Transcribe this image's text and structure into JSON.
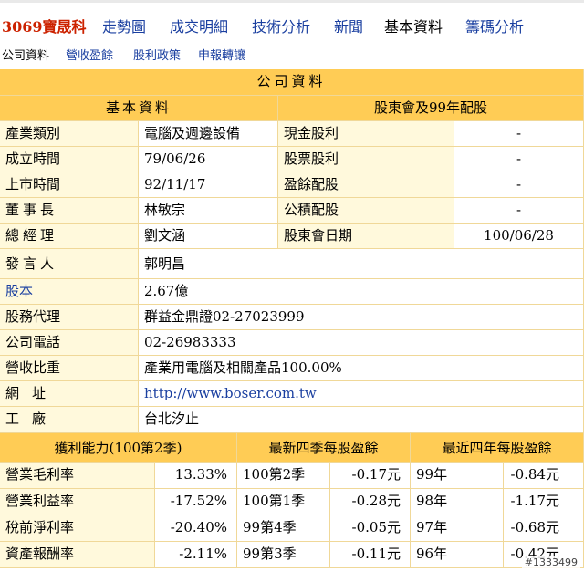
{
  "nav": {
    "stock": "3069寶晟科",
    "tabs": [
      "走勢圖",
      "成交明細",
      "技術分析",
      "新聞",
      "基本資料",
      "籌碼分析"
    ],
    "active_tab": "基本資料"
  },
  "subnav": [
    "公司資料",
    "營收盈餘",
    "股利政策",
    "申報轉讓"
  ],
  "section_title": "公司資料",
  "basic": {
    "header": "基本資料",
    "rows": [
      {
        "label": "產業類別",
        "value": "電腦及週邊設備"
      },
      {
        "label": "成立時間",
        "value": "79/06/26"
      },
      {
        "label": "上市時間",
        "value": "92/11/17"
      },
      {
        "label": "董事長",
        "value": "林敏宗"
      },
      {
        "label": "總經理",
        "value": "劉文涵"
      }
    ]
  },
  "dividend": {
    "header": "股東會及99年配股",
    "rows": [
      {
        "label": "現金股利",
        "value": "-"
      },
      {
        "label": "股票股利",
        "value": "-"
      },
      {
        "label": "盈餘配股",
        "value": "-"
      },
      {
        "label": "公積配股",
        "value": "-"
      },
      {
        "label": "股東會日期",
        "value": "100/06/28"
      }
    ]
  },
  "info": [
    {
      "label": "發言人",
      "value": "郭明昌"
    },
    {
      "label": "股本",
      "value": "2.67億"
    },
    {
      "label": "股務代理",
      "value": "群益金鼎證02-27023999"
    },
    {
      "label": "公司電話",
      "value": "02-26983333"
    },
    {
      "label": "營收比重",
      "value": "產業用電腦及相關產品100.00%"
    },
    {
      "label": "網址",
      "value": "http://www.boser.com.tw"
    },
    {
      "label": "工廠",
      "value": "台北汐止"
    }
  ],
  "profit": {
    "header": "獲利能力(100第2季)",
    "rows": [
      {
        "label": "營業毛利率",
        "value": "13.33%"
      },
      {
        "label": "營業利益率",
        "value": "-17.52%"
      },
      {
        "label": "稅前淨利率",
        "value": "-20.40%"
      },
      {
        "label": "資產報酬率",
        "value": "-2.11%"
      }
    ]
  },
  "eps4q": {
    "header": "最新四季每股盈餘",
    "rows": [
      {
        "period": "100第2季",
        "value": "-0.17元"
      },
      {
        "period": "100第1季",
        "value": "-0.28元"
      },
      {
        "period": "99第4季",
        "value": "-0.05元"
      },
      {
        "period": "99第3季",
        "value": "-0.11元"
      }
    ]
  },
  "eps4y": {
    "header": "最近四年每股盈餘",
    "rows": [
      {
        "period": "99年",
        "value": "-0.84元"
      },
      {
        "period": "98年",
        "value": "-1.17元"
      },
      {
        "period": "97年",
        "value": "-0.68元"
      },
      {
        "period": "96年",
        "value": "-0.42元"
      }
    ]
  },
  "watermark": "#1333499",
  "colors": {
    "header_bg": "#ffcc55",
    "label_bg": "#fff9dc",
    "link": "#1a3fa0",
    "stock": "#cc2200"
  }
}
